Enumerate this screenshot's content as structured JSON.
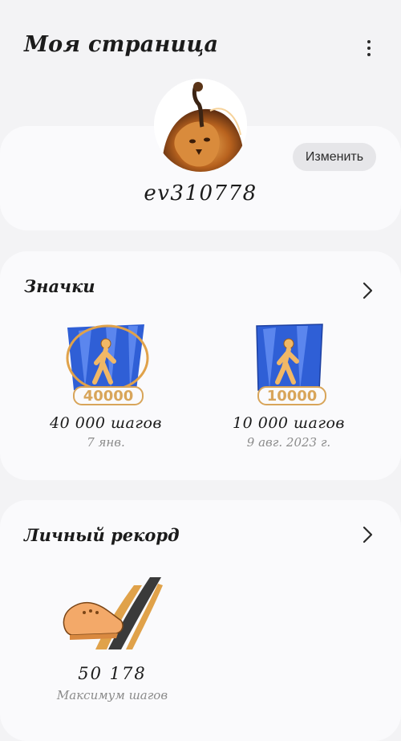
{
  "header": {
    "title": "Моя страница",
    "more_icon": "more-vert-icon"
  },
  "profile": {
    "username": "ev310778",
    "edit_label": "Изменить",
    "avatar_icon": "lion-avatar-image"
  },
  "badges": {
    "title": "Значки",
    "items": [
      {
        "label": "40 000 шагов",
        "date": "7 янв.",
        "emblem_number": "40000",
        "ring": "gold"
      },
      {
        "label": "10 000 шагов",
        "date": "9 авг. 2023 г.",
        "emblem_number": "10000",
        "ring": "none"
      }
    ]
  },
  "personal_record": {
    "title": "Личный рекорд",
    "value": "50 178",
    "caption": "Максимум шагов"
  },
  "colors": {
    "background": "#f3f3f5",
    "card": "#fafafc",
    "badge_blue": "#2f5fd6",
    "gold": "#e0a24a",
    "shoe_orange": "#f3a969"
  }
}
